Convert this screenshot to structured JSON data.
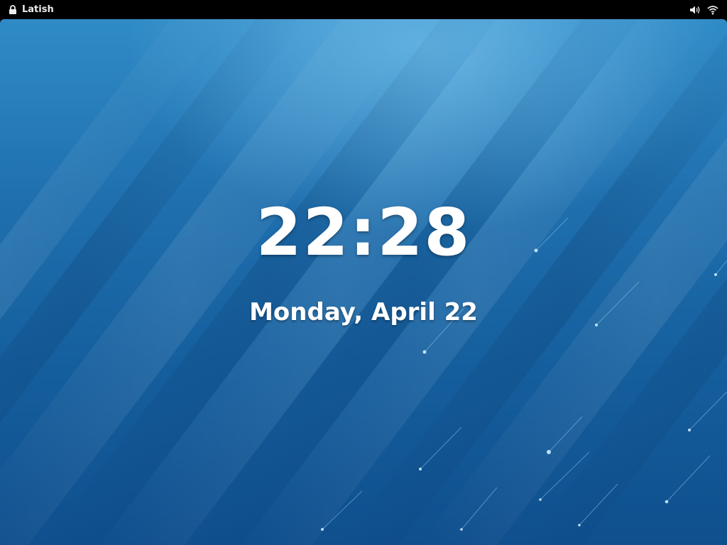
{
  "topbar": {
    "user_name": "Latish",
    "lock_icon": "lock-icon",
    "volume_icon": "speaker-volume-icon",
    "network_icon": "wifi-icon"
  },
  "lockscreen": {
    "time": "22:28",
    "date": "Monday, April 22"
  },
  "colors": {
    "topbar_bg": "#000000",
    "wallpaper_top": "#2f8bc6",
    "wallpaper_bottom": "#0f4f8d",
    "text": "#ffffff"
  }
}
